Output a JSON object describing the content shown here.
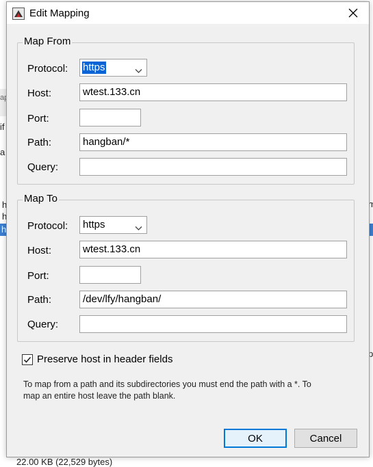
{
  "window": {
    "title": "Edit Mapping"
  },
  "map_from": {
    "legend": "Map From",
    "protocol_label": "Protocol:",
    "protocol_value": "https",
    "host_label": "Host:",
    "host_value": "wtest.133.cn",
    "port_label": "Port:",
    "port_value": "",
    "path_label": "Path:",
    "path_value": "hangban/*",
    "query_label": "Query:",
    "query_value": ""
  },
  "map_to": {
    "legend": "Map To",
    "protocol_label": "Protocol:",
    "protocol_value": "https",
    "host_label": "Host:",
    "host_value": "wtest.133.cn",
    "port_label": "Port:",
    "port_value": "",
    "path_label": "Path:",
    "path_value": "/dev/lfy/hangban/",
    "query_label": "Query:",
    "query_value": ""
  },
  "preserve_host": {
    "label": "Preserve host in header fields",
    "checked": true
  },
  "help_text": {
    "line1": "To map from a path and its subdirectories you must end the path with a *. To",
    "line2": "map an entire host leave the path blank."
  },
  "buttons": {
    "ok": "OK",
    "cancel": "Cancel"
  },
  "background": {
    "status_text": "22.00 KB (22,529 bytes)",
    "frag_a": "ap",
    "frag_b": "if",
    "frag_c": "a",
    "frag_d": "h",
    "frag_e": "h",
    "frag_f": "h",
    "frag_g": "m",
    "frag_h": "p"
  }
}
